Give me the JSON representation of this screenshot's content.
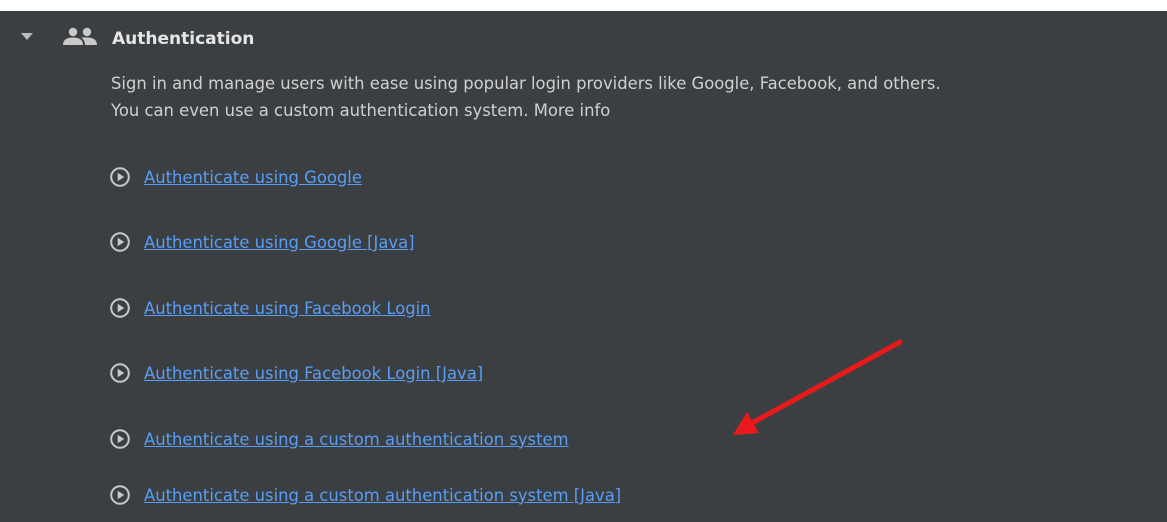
{
  "section": {
    "title": "Authentication",
    "description_line1": "Sign in and manage users with ease using popular login providers like Google, Facebook, and others.",
    "description_line2_prefix": "You can even use a custom authentication system.",
    "more_info_label": "More info",
    "links": [
      "Authenticate using Google",
      "Authenticate using Google [Java]",
      "Authenticate using Facebook Login",
      "Authenticate using Facebook Login [Java]",
      "Authenticate using a custom authentication system",
      "Authenticate using a custom authentication system [Java]"
    ]
  },
  "colors": {
    "panel_background": "#3c3f41",
    "link": "#589df6",
    "text": "#d0d0d0",
    "annotation_arrow": "#e8191b"
  },
  "icons": {
    "collapse": "triangle-down-icon",
    "section": "people-icon",
    "link": "play-circle-icon",
    "annotation": "red-arrow"
  }
}
